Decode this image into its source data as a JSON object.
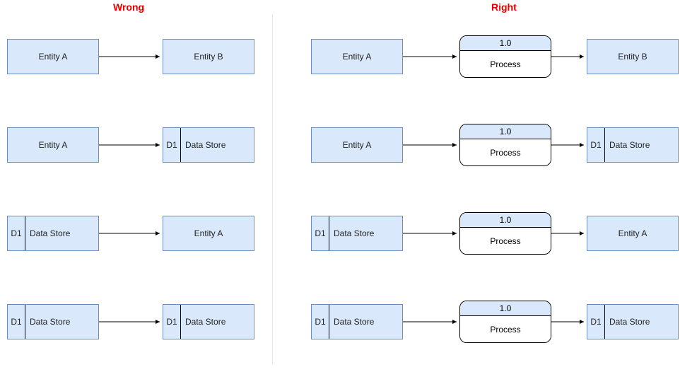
{
  "headers": {
    "wrong": "Wrong",
    "right": "Right"
  },
  "labels": {
    "entityA": "Entity A",
    "entityB": "Entity B",
    "processId": "1.0",
    "processName": "Process",
    "dsId": "D1",
    "dsName": "Data Store"
  },
  "diagram": {
    "left_column": "Wrong",
    "right_column": "Right",
    "rows": [
      {
        "wrong": [
          "Entity A",
          "Entity B"
        ],
        "right": [
          "Entity A",
          "Process 1.0",
          "Entity B"
        ]
      },
      {
        "wrong": [
          "Entity A",
          "D1 Data Store"
        ],
        "right": [
          "Entity A",
          "Process 1.0",
          "D1 Data Store"
        ]
      },
      {
        "wrong": [
          "D1 Data Store",
          "Entity A"
        ],
        "right": [
          "D1 Data Store",
          "Process 1.0",
          "Entity A"
        ]
      },
      {
        "wrong": [
          "D1 Data Store",
          "D1 Data Store"
        ],
        "right": [
          "D1 Data Store",
          "Process 1.0",
          "D1 Data Store"
        ]
      }
    ]
  }
}
